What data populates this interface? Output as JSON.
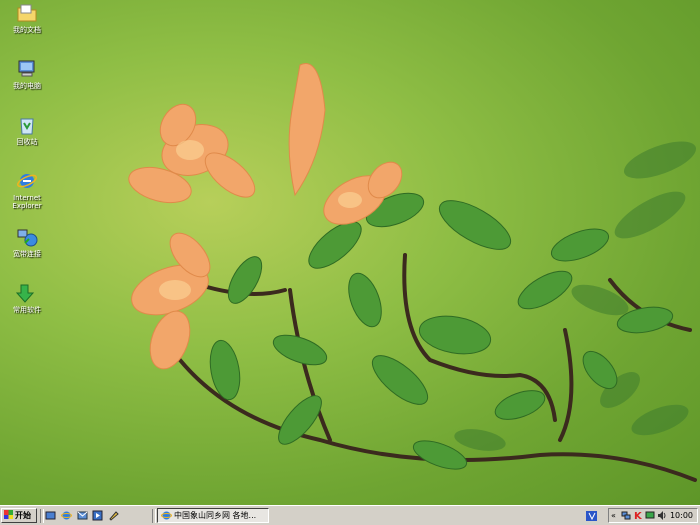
{
  "desktop": {
    "icons": [
      {
        "name": "my-documents-icon",
        "label": "我的文档"
      },
      {
        "name": "my-computer-icon",
        "label": "我的电脑"
      },
      {
        "name": "recycle-bin-icon",
        "label": "回收站"
      },
      {
        "name": "internet-explorer-icon",
        "label": "Internet Explorer"
      },
      {
        "name": "broadband-connection-icon",
        "label": "宽带连接"
      },
      {
        "name": "common-software-icon",
        "label": "常用软件"
      }
    ],
    "wallpaper": "orange-azalea-flowers-on-branch"
  },
  "taskbar": {
    "start_label": "开始",
    "quick_launch": [
      "show-desktop-icon",
      "ie-icon",
      "outlook-icon",
      "media-icon",
      "pen-icon"
    ],
    "task": {
      "icon": "ie-icon",
      "label": "中国象山同乡网 各地..."
    },
    "tray": {
      "icons": [
        "chevron-icon",
        "network-icon",
        "antivirus-k-icon",
        "monitor-icon",
        "volume-icon"
      ],
      "clock": "10:00"
    }
  },
  "colors": {
    "taskbar": "#d4d0c8",
    "wallpaper": "#8fbe45",
    "petal": "#f2a66a"
  }
}
